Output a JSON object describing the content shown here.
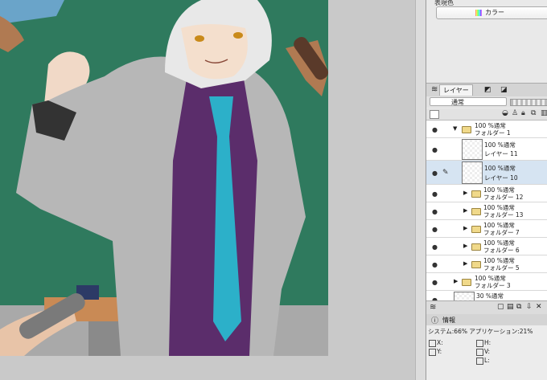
{
  "color_section": {
    "title": "表現色",
    "value": "カラー"
  },
  "tabs": [
    {
      "label": "レイヤー",
      "active": true
    }
  ],
  "blend_mode": "通常",
  "layers": [
    {
      "line1": "100 %通常",
      "line2": "フォルダー 1",
      "type": "folder",
      "expanded": true
    },
    {
      "line1": "100 %通常",
      "line2": "レイヤー 11",
      "type": "layer"
    },
    {
      "line1": "100 %通常",
      "line2": "レイヤー 10",
      "type": "layer",
      "selected": true
    },
    {
      "line1": "100 %通常",
      "line2": "フォルダー 12",
      "type": "folder"
    },
    {
      "line1": "100 %通常",
      "line2": "フォルダー 13",
      "type": "folder"
    },
    {
      "line1": "100 %通常",
      "line2": "フォルダー 7",
      "type": "folder"
    },
    {
      "line1": "100 %通常",
      "line2": "フォルダー 6",
      "type": "folder"
    },
    {
      "line1": "100 %通常",
      "line2": "フォルダー 5",
      "type": "folder"
    },
    {
      "line1": "100 %通常",
      "line2": "フォルダー 3",
      "type": "folder"
    },
    {
      "line1": "30 %通常",
      "line2": "",
      "type": "layer"
    }
  ],
  "info": {
    "tab_label": "情報",
    "system_line": "システム:66% アプリケーション:21%",
    "x_label": "X:",
    "y_label": "Y:",
    "h_label": "H:",
    "v_label": "V:",
    "l_label": "L:"
  }
}
